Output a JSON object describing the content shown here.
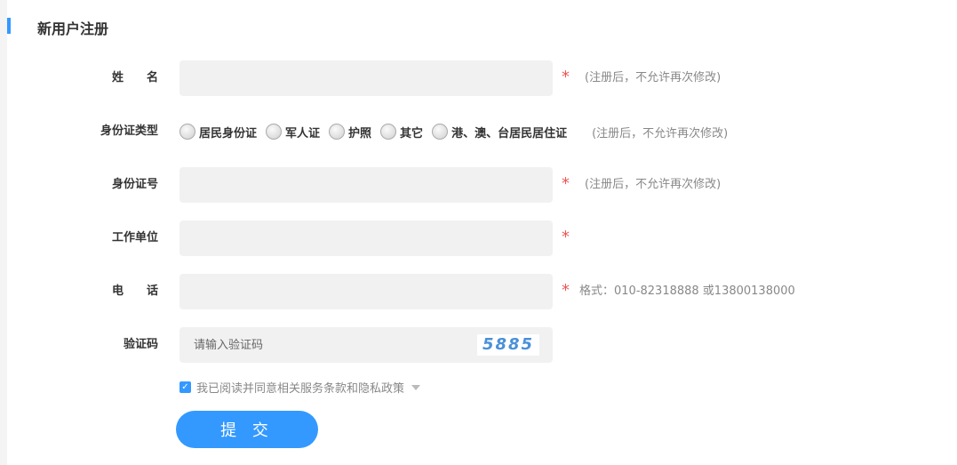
{
  "title": "新用户注册",
  "fields": {
    "name": {
      "label": "姓　　名",
      "hint": "(注册后，不允许再次修改)"
    },
    "id_type": {
      "label": "身份证类型",
      "options": [
        "居民身份证",
        "军人证",
        "护照",
        "其它",
        "港、澳、台居民居住证"
      ],
      "hint": "(注册后，不允许再次修改)"
    },
    "id_number": {
      "label": "身份证号",
      "hint": "(注册后，不允许再次修改)"
    },
    "work_unit": {
      "label": "工作单位"
    },
    "phone": {
      "label": "电　　话",
      "hint": "格式：010-82318888 或13800138000"
    },
    "captcha": {
      "label": "验证码",
      "placeholder": "请输入验证码",
      "code": "5885"
    }
  },
  "required_mark": "*",
  "agree": {
    "label": "我已阅读并同意相关服务条款和隐私政策",
    "checked": true
  },
  "submit_label": "提 交",
  "colors": {
    "accent": "#3399ff",
    "required": "#ee5555"
  }
}
